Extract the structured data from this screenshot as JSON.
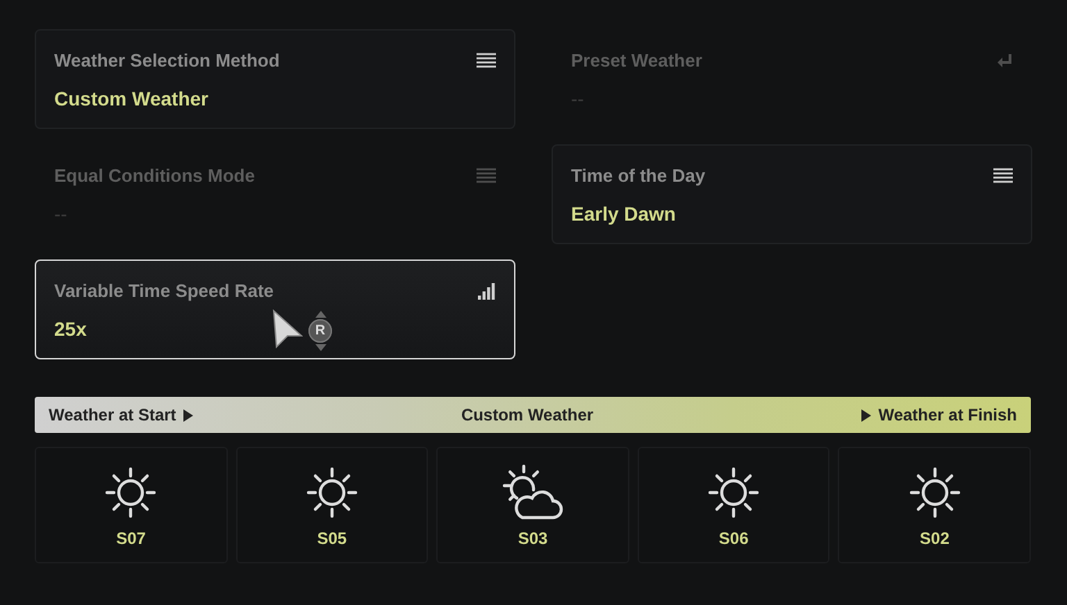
{
  "settings": [
    {
      "label": "Weather Selection Method",
      "value": "Custom Weather",
      "kind": "list",
      "disabled": false,
      "selected": false
    },
    {
      "label": "Preset Weather",
      "value": "--",
      "kind": "enter",
      "disabled": true,
      "selected": false
    },
    {
      "label": "Equal Conditions Mode",
      "value": "--",
      "kind": "list",
      "disabled": true,
      "selected": false
    },
    {
      "label": "Time of the Day",
      "value": "Early Dawn",
      "kind": "list",
      "disabled": false,
      "selected": false
    },
    {
      "label": "Variable Time Speed Rate",
      "value": "25x",
      "kind": "bars",
      "disabled": false,
      "selected": true
    }
  ],
  "cursor_hint": {
    "button": "R"
  },
  "timeline": {
    "start": "Weather at Start",
    "title": "Custom Weather",
    "finish": "Weather at Finish"
  },
  "slots": [
    {
      "code": "S07",
      "kind": "sun"
    },
    {
      "code": "S05",
      "kind": "sun"
    },
    {
      "code": "S03",
      "kind": "partly-cloudy"
    },
    {
      "code": "S06",
      "kind": "sun"
    },
    {
      "code": "S02",
      "kind": "sun"
    }
  ]
}
